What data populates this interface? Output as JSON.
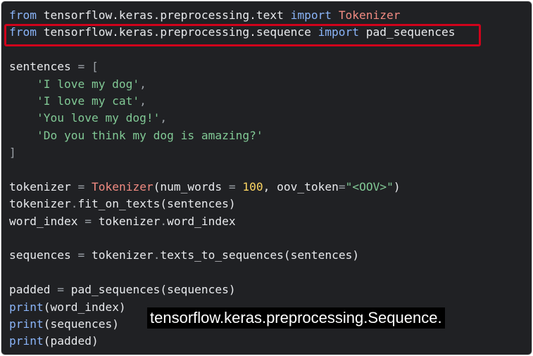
{
  "code": {
    "lines": [
      [
        {
          "t": "from",
          "k": "kw"
        },
        {
          "t": " tensorflow.keras.preprocessing.text ",
          "k": "txt"
        },
        {
          "t": "import",
          "k": "kw"
        },
        {
          "t": " ",
          "k": "txt"
        },
        {
          "t": "Tokenizer",
          "k": "cls"
        }
      ],
      [
        {
          "t": "from",
          "k": "kw"
        },
        {
          "t": " tensorflow.keras.preprocessing.sequence ",
          "k": "txt"
        },
        {
          "t": "import",
          "k": "kw"
        },
        {
          "t": " pad_sequences",
          "k": "txt"
        }
      ],
      [],
      [
        {
          "t": "sentences ",
          "k": "txt"
        },
        {
          "t": "=",
          "k": "op"
        },
        {
          "t": " ",
          "k": "txt"
        },
        {
          "t": "[",
          "k": "op"
        }
      ],
      [
        {
          "t": "    ",
          "k": "txt"
        },
        {
          "t": "'I love my dog'",
          "k": "str"
        },
        {
          "t": ",",
          "k": "op"
        }
      ],
      [
        {
          "t": "    ",
          "k": "txt"
        },
        {
          "t": "'I love my cat'",
          "k": "str"
        },
        {
          "t": ",",
          "k": "op"
        }
      ],
      [
        {
          "t": "    ",
          "k": "txt"
        },
        {
          "t": "'You love my dog!'",
          "k": "str"
        },
        {
          "t": ",",
          "k": "op"
        }
      ],
      [
        {
          "t": "    ",
          "k": "txt"
        },
        {
          "t": "'Do you think my dog is amazing?'",
          "k": "str"
        }
      ],
      [
        {
          "t": "]",
          "k": "op"
        }
      ],
      [],
      [
        {
          "t": "tokenizer ",
          "k": "txt"
        },
        {
          "t": "=",
          "k": "op"
        },
        {
          "t": " ",
          "k": "txt"
        },
        {
          "t": "Tokenizer",
          "k": "cls"
        },
        {
          "t": "(num_words ",
          "k": "txt"
        },
        {
          "t": "=",
          "k": "op"
        },
        {
          "t": " ",
          "k": "txt"
        },
        {
          "t": "100",
          "k": "num"
        },
        {
          "t": ", oov_token",
          "k": "txt"
        },
        {
          "t": "=",
          "k": "op"
        },
        {
          "t": "\"<OOV>\"",
          "k": "str"
        },
        {
          "t": ")",
          "k": "txt"
        }
      ],
      [
        {
          "t": "tokenizer",
          "k": "txt"
        },
        {
          "t": ".",
          "k": "op"
        },
        {
          "t": "fit_on_texts(sentences)",
          "k": "txt"
        }
      ],
      [
        {
          "t": "word_index ",
          "k": "txt"
        },
        {
          "t": "=",
          "k": "op"
        },
        {
          "t": " tokenizer",
          "k": "txt"
        },
        {
          "t": ".",
          "k": "op"
        },
        {
          "t": "word_index",
          "k": "txt"
        }
      ],
      [],
      [
        {
          "t": "sequences ",
          "k": "txt"
        },
        {
          "t": "=",
          "k": "op"
        },
        {
          "t": " tokenizer",
          "k": "txt"
        },
        {
          "t": ".",
          "k": "op"
        },
        {
          "t": "texts_to_sequences(sentences)",
          "k": "txt"
        }
      ],
      [],
      [
        {
          "t": "padded ",
          "k": "txt"
        },
        {
          "t": "=",
          "k": "op"
        },
        {
          "t": " pad_sequences(sequences)",
          "k": "txt"
        }
      ],
      [
        {
          "t": "print",
          "k": "kw"
        },
        {
          "t": "(word_index)",
          "k": "txt"
        }
      ],
      [
        {
          "t": "print",
          "k": "kw"
        },
        {
          "t": "(sequences)",
          "k": "txt"
        }
      ],
      [
        {
          "t": "print",
          "k": "kw"
        },
        {
          "t": "(padded)",
          "k": "txt"
        }
      ]
    ]
  },
  "caption": {
    "text": "tensorflow.keras.preprocessing.Sequence."
  },
  "colors": {
    "background": "#202124",
    "keyword": "#8ab4f8",
    "class_name": "#f28b82",
    "string": "#81c995",
    "number": "#fdd663",
    "highlight_box": "#d0021b",
    "caption_background": "#000000",
    "caption_text": "#ffffff"
  }
}
